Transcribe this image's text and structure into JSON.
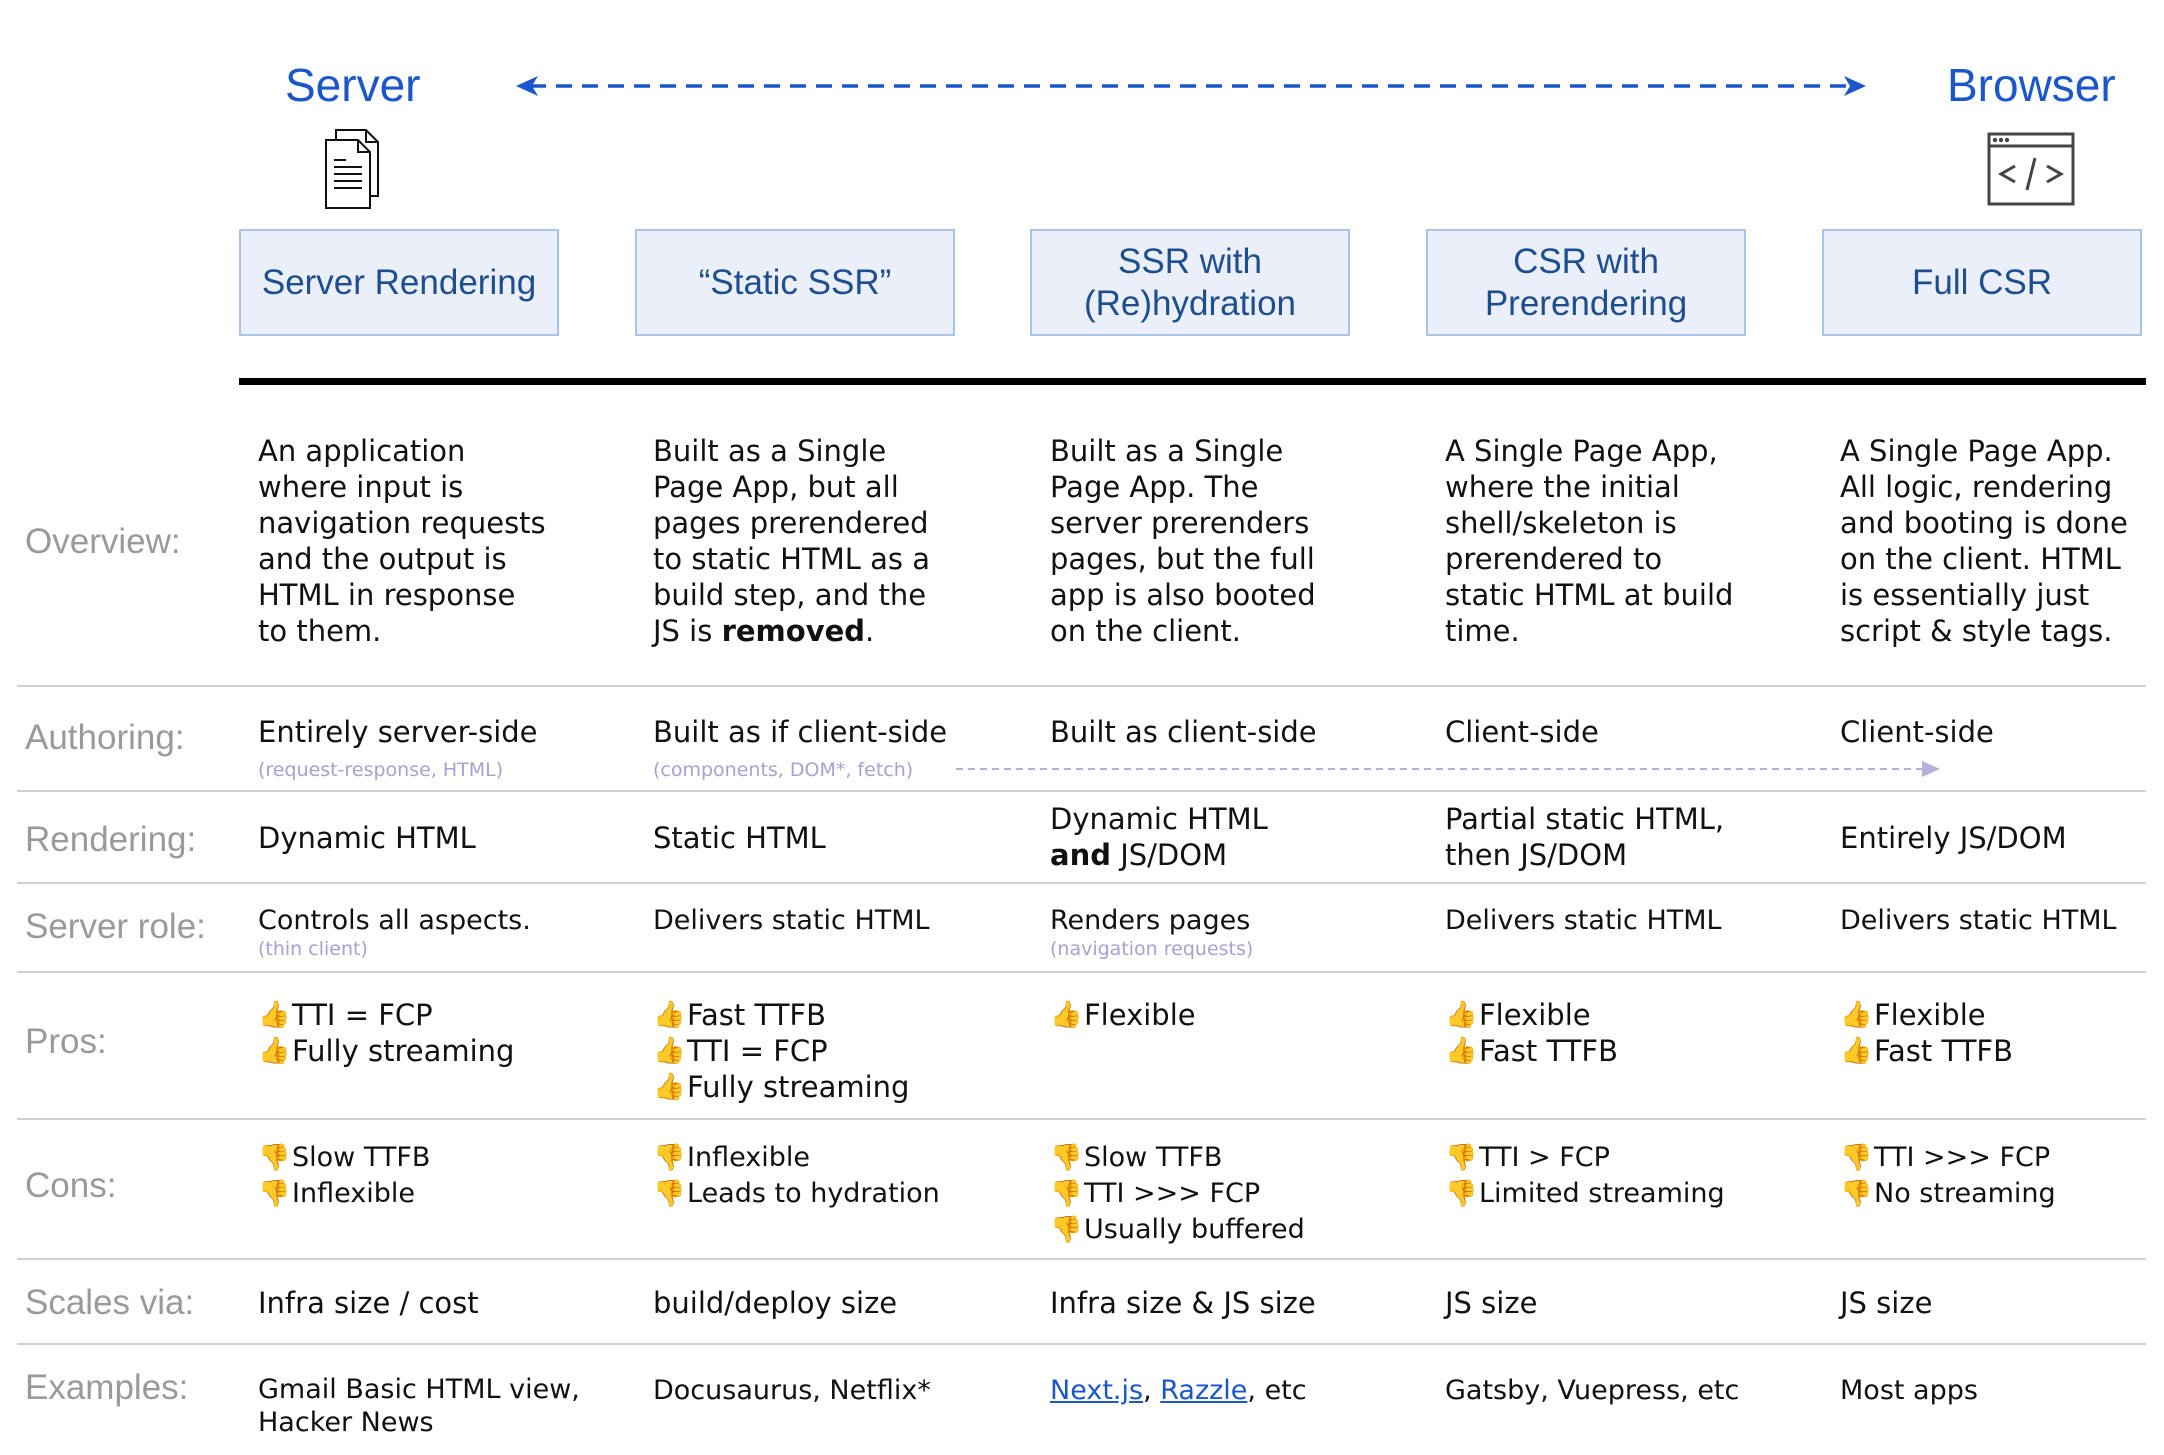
{
  "ends": {
    "left": "Server",
    "right": "Browser",
    "left_icon": "document-stack-icon",
    "right_icon": "browser-code-icon"
  },
  "accent": "#1a56cc",
  "columns": [
    "Server Rendering",
    "“Static SSR”",
    "SSR with\n(Re)hydration",
    "CSR with\nPrerendering",
    "Full CSR"
  ],
  "rows": {
    "overview": {
      "label": "Overview:",
      "cells": [
        "An application\nwhere input is\nnavigation requests\nand the output is\nHTML in response\nto them.",
        {
          "pre": "Built as a Single\nPage App, but all\npages prerendered\nto static HTML as a\nbuild step, and the\nJS is ",
          "bold": "removed",
          "post": "."
        },
        "Built as a Single\nPage App. The\nserver prerenders\npages, but the full\napp is also booted\non the client.",
        "A Single Page App,\nwhere the initial\nshell/skeleton is\nprerendered to\nstatic HTML at build\ntime.",
        "A Single Page App.\nAll logic, rendering\nand booting is done\non the client. HTML\nis essentially just\nscript & style tags."
      ]
    },
    "authoring": {
      "label": "Authoring:",
      "cells": [
        "Entirely server-side",
        "Built as if client-side",
        "Built as client-side",
        "Client-side",
        "Client-side"
      ],
      "subs": [
        "(request-response, HTML)",
        "(components, DOM*, fetch)",
        "",
        "",
        ""
      ]
    },
    "rendering": {
      "label": "Rendering:",
      "cells": [
        "Dynamic HTML",
        "Static HTML",
        {
          "pre": "Dynamic HTML\n",
          "bold": "and",
          "post": " JS/DOM"
        },
        "Partial static HTML,\nthen JS/DOM",
        "Entirely JS/DOM"
      ]
    },
    "server_role": {
      "label": "Server role:",
      "cells": [
        "Controls all aspects.",
        "Delivers static HTML",
        "Renders pages",
        "Delivers static HTML",
        "Delivers static HTML"
      ],
      "subs": [
        "(thin client)",
        "",
        "(navigation requests)",
        "",
        ""
      ]
    },
    "pros": {
      "label": "Pros:",
      "icon": "👍",
      "cells": [
        [
          "TTI = FCP",
          "Fully streaming"
        ],
        [
          "Fast TTFB",
          "TTI = FCP",
          "Fully streaming"
        ],
        [
          "Flexible"
        ],
        [
          "Flexible",
          "Fast TTFB"
        ],
        [
          "Flexible",
          "Fast TTFB"
        ]
      ]
    },
    "cons": {
      "label": "Cons:",
      "icon": "👎",
      "cells": [
        [
          "Slow TTFB",
          "Inflexible"
        ],
        [
          "Inflexible",
          "Leads to hydration"
        ],
        [
          "Slow TTFB",
          "TTI >>> FCP",
          "Usually buffered"
        ],
        [
          "TTI > FCP",
          "Limited streaming"
        ],
        [
          "TTI >>> FCP",
          "No streaming"
        ]
      ]
    },
    "scales_via": {
      "label": "Scales via:",
      "cells": [
        "Infra size / cost",
        "build/deploy size",
        "Infra size & JS size",
        "JS size",
        "JS size"
      ]
    },
    "examples": {
      "label": "Examples:",
      "cells": [
        "Gmail Basic HTML view,\nHacker News",
        "Docusaurus, Netflix*",
        "",
        "Gatsby, Vuepress, etc",
        "Most apps"
      ],
      "links": [
        "Next.js",
        "Razzle"
      ],
      "links_suffix": ", etc"
    }
  }
}
